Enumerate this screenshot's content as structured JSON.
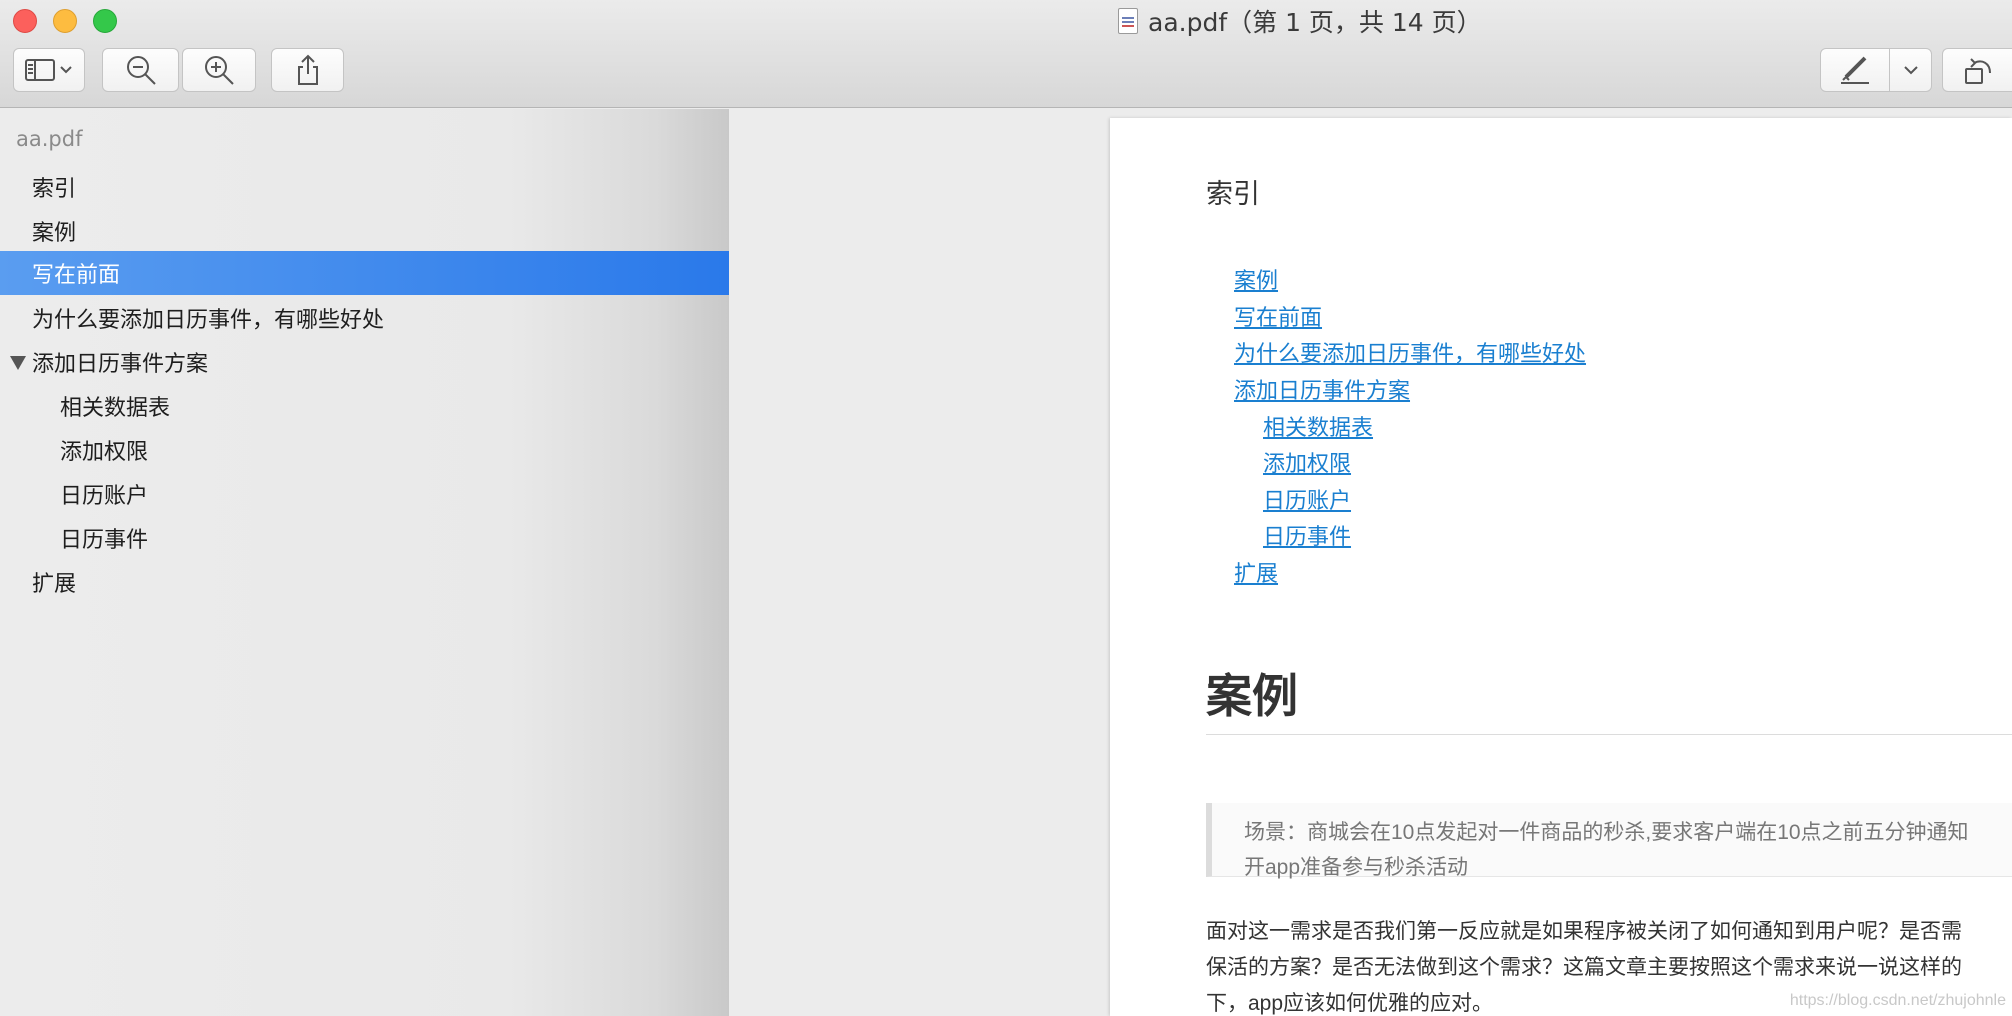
{
  "window": {
    "title": "aa.pdf（第 1 页，共 14 页）"
  },
  "toolbar": {
    "sidebar_toggle": "sidebar-toggle-icon",
    "zoom_out": "zoom-out-icon",
    "zoom_in": "zoom-in-icon",
    "share": "share-icon",
    "markup": "pen-markup-icon",
    "rotate": "rotate-icon"
  },
  "sidebar": {
    "root": "aa.pdf",
    "items": [
      {
        "label": "索引"
      },
      {
        "label": "案例"
      },
      {
        "label": "写在前面",
        "selected": true
      },
      {
        "label": "为什么要添加日历事件，有哪些好处"
      },
      {
        "label": "添加日历事件方案",
        "expanded": true
      },
      {
        "label": "相关数据表"
      },
      {
        "label": "添加权限"
      },
      {
        "label": "日历账户"
      },
      {
        "label": "日历事件"
      },
      {
        "label": "扩展"
      }
    ]
  },
  "page": {
    "index_title": "索引",
    "toc": [
      "案例",
      "写在前面",
      "为什么要添加日历事件，有哪些好处",
      "添加日历事件方案",
      "相关数据表",
      "添加权限",
      "日历账户",
      "日历事件",
      "扩展"
    ],
    "heading": "案例",
    "quote_lines": [
      "场景：商城会在10点发起对一件商品的秒杀,要求客户端在10点之前五分钟通知",
      "开app准备参与秒杀活动"
    ],
    "body_lines": [
      "面对这一需求是否我们第一反应就是如果程序被关闭了如何通知到用户呢？是否需",
      "保活的方案？是否无法做到这个需求？这篇文章主要按照这个需求来说一说这样的",
      "下，app应该如何优雅的应对。"
    ],
    "watermark": "https://blog.csdn.net/zhujohnle"
  },
  "colors": {
    "selection": "#2a79ea",
    "link": "#1a7fd0"
  }
}
